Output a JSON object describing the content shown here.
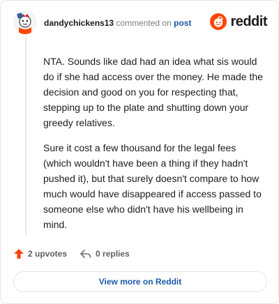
{
  "comment": {
    "username": "dandychickens13",
    "commented_text": "commented on",
    "post_link": "post",
    "paragraphs": [
      "NTA. Sounds like dad had an idea what sis would do if she had access over the money. He made the decision and good on you for respecting that, stepping up to the plate and shutting down your greedy relatives.",
      "Sure it cost a few thousand for the legal fees (which wouldn't have been a thing if they hadn't pushed it), but that surely doesn't compare to how much would have disappeared if access passed to someone else who didn't have his wellbeing in mind."
    ]
  },
  "brand": {
    "wordmark": "reddit",
    "icon": "reddit-snoo-icon",
    "accent": "#ff4500"
  },
  "actions": {
    "upvotes": "2 upvotes",
    "replies": "0 replies"
  },
  "footer": {
    "view_more": "View more on Reddit"
  },
  "colors": {
    "link": "#1a5aa8",
    "upvote": "#ff4500",
    "muted": "#7c7c7c"
  }
}
